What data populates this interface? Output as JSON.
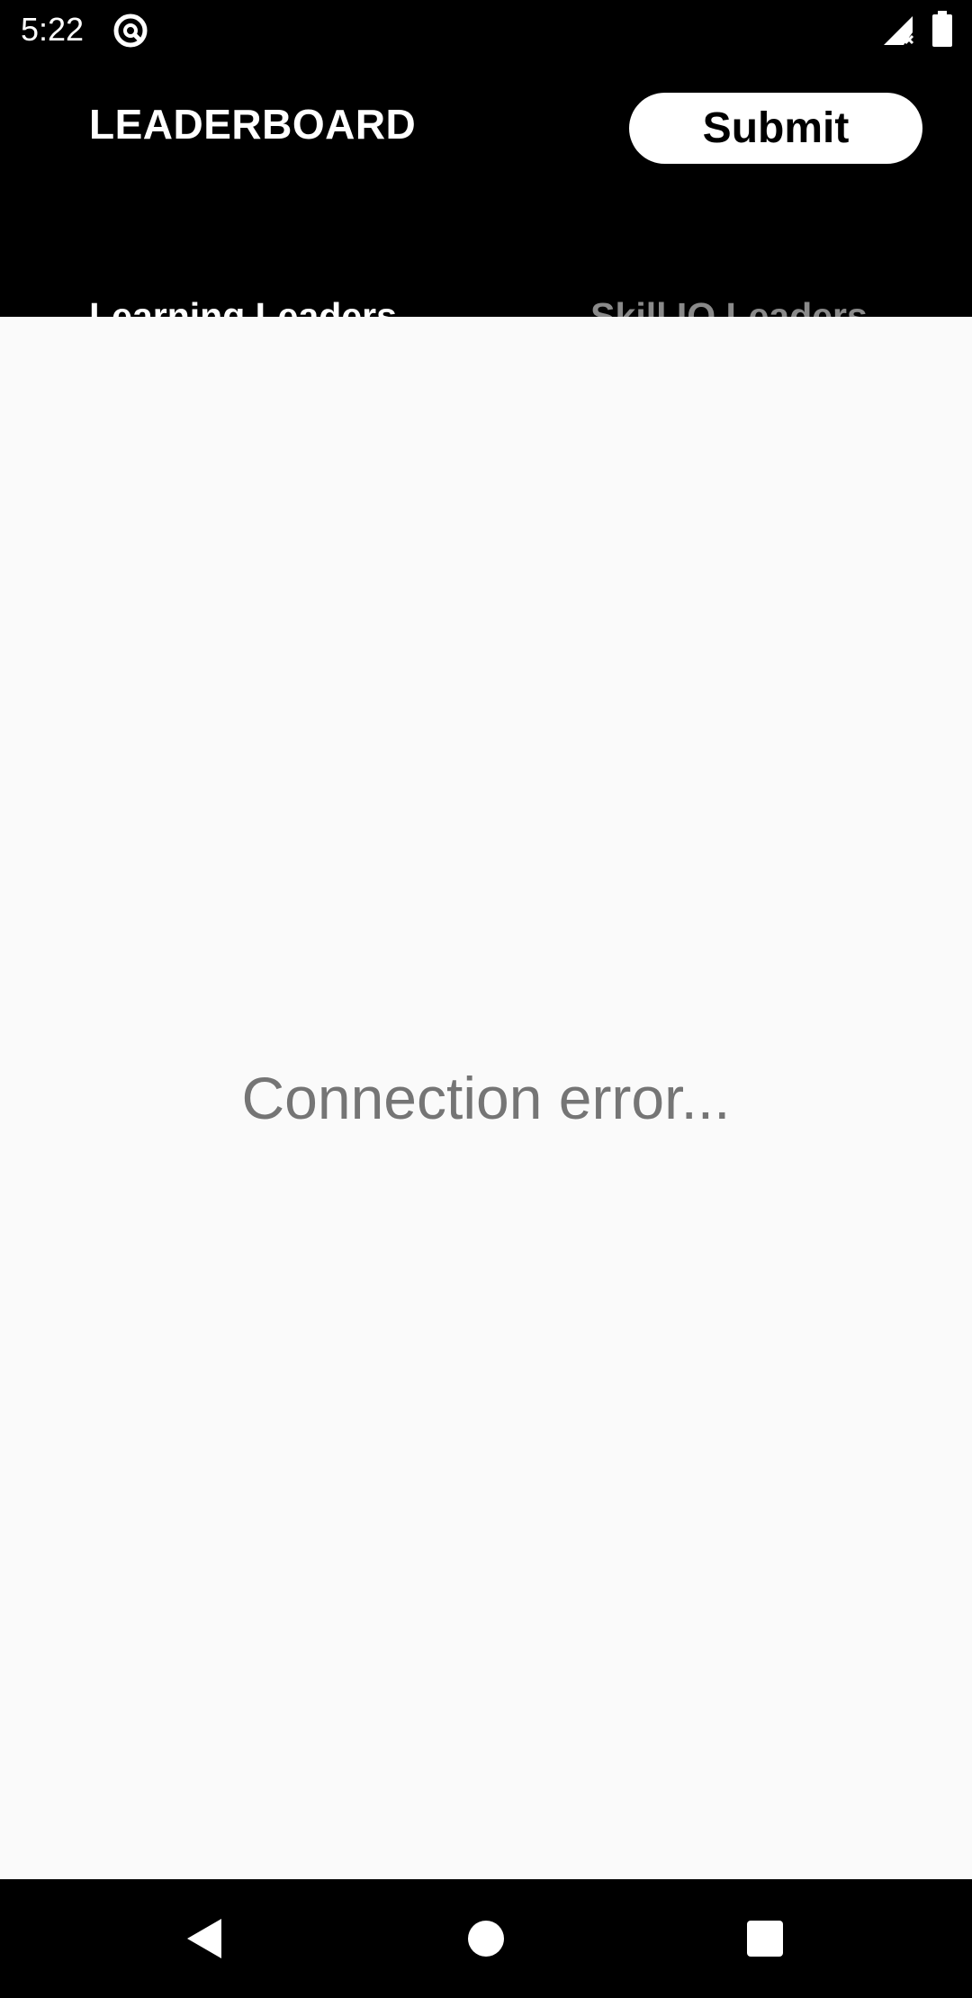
{
  "status_bar": {
    "time": "5:22",
    "icons": [
      "app-notification-icon",
      "signal-icon",
      "battery-icon"
    ]
  },
  "header": {
    "title": "LEADERBOARD",
    "submit_label": "Submit"
  },
  "tabs": [
    {
      "label": "Learning Leaders",
      "selected": true
    },
    {
      "label": "Skill IQ Leaders",
      "selected": false
    }
  ],
  "main": {
    "message": "Connection error..."
  },
  "nav_bar": {
    "icons": [
      "back-icon",
      "home-icon",
      "recents-icon"
    ]
  },
  "colors": {
    "app_bar": "#000000",
    "content_bg": "#fafafa",
    "active_tab": "#ffffff",
    "inactive_tab": "#8a8a8a",
    "message": "#757575"
  }
}
